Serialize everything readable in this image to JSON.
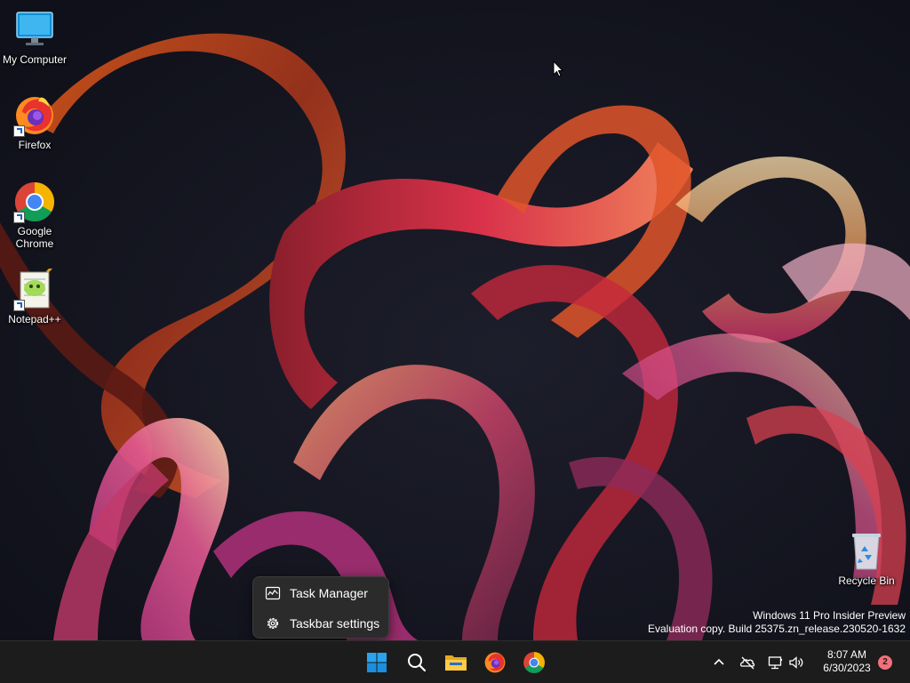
{
  "desktop": {
    "icons": [
      {
        "label": "My Computer",
        "icon": "monitor-icon"
      },
      {
        "label": "Firefox",
        "icon": "firefox-icon"
      },
      {
        "label": "Google\nChrome",
        "icon": "chrome-icon"
      },
      {
        "label": "Notepad++",
        "icon": "notepadpp-icon"
      },
      {
        "label": "Recycle Bin",
        "icon": "recycle-bin-icon"
      }
    ],
    "watermark": {
      "line1": "Windows 11 Pro Insider Preview",
      "line2": "Evaluation copy. Build 25375.zn_release.230520-1632"
    }
  },
  "context_menu": {
    "items": [
      {
        "label": "Task Manager",
        "icon": "task-manager-icon"
      },
      {
        "label": "Taskbar settings",
        "icon": "gear-icon"
      }
    ]
  },
  "taskbar": {
    "apps": [
      "start-icon",
      "search-icon",
      "file-explorer-icon",
      "firefox-icon",
      "chrome-icon"
    ],
    "tray": [
      "chevron-up-icon",
      "onedrive-offline-icon",
      "network-icon",
      "volume-icon"
    ],
    "clock": {
      "time": "8:07 AM",
      "date": "6/30/2023"
    },
    "notification_count": "2"
  },
  "colors": {
    "taskbar_bg": "#1c1c1c",
    "menu_bg": "#2b2b2b",
    "badge": "#f1707b",
    "accent": "#0078d4"
  }
}
